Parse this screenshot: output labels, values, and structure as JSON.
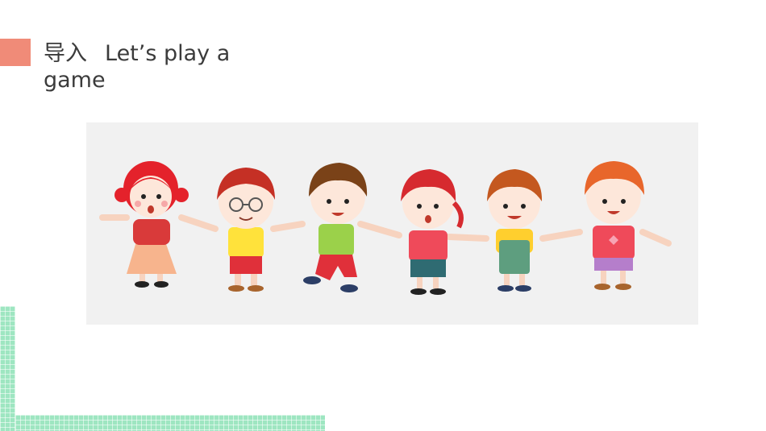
{
  "slide": {
    "title_cn": "导入",
    "title_en_line1": "Let’s play a",
    "title_en_line2": "game"
  },
  "colors": {
    "accent": "#f08b78",
    "grid": "#9ee6c1",
    "text": "#3b3b3b",
    "picture_bg": "#f1f1f1"
  },
  "illustration": {
    "subject": "cartoon-children-holding-hands",
    "count": 6
  }
}
